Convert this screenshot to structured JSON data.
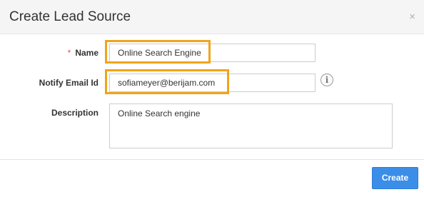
{
  "dialog": {
    "title": "Create Lead Source",
    "close_symbol": "×"
  },
  "form": {
    "name": {
      "required_marker": "*",
      "label": "Name",
      "value": "Online Search Engine"
    },
    "notify_email": {
      "label": "Notify Email Id",
      "value": "sofiameyer@berijam.com",
      "info_symbol": "i"
    },
    "description": {
      "label": "Description",
      "value": "Online Search engine"
    }
  },
  "footer": {
    "create_label": "Create"
  },
  "colors": {
    "highlight": "#f0a41a",
    "primary_button": "#3b8ee8",
    "required": "#d9534f"
  },
  "icons": {
    "close": "close-icon",
    "info": "info-icon"
  }
}
